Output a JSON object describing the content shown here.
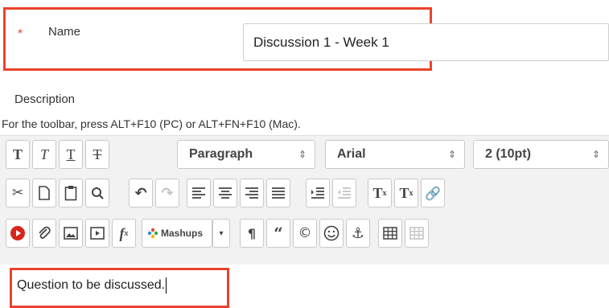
{
  "name_field": {
    "required_mark": "*",
    "label": "Name",
    "value": "Discussion 1 - Week 1"
  },
  "description": {
    "label": "Description",
    "toolbar_hint": "For the toolbar, press ALT+F10 (PC) or ALT+FN+F10 (Mac)."
  },
  "toolbar": {
    "format_select": "Paragraph",
    "font_select": "Arial",
    "size_select": "2 (10pt)",
    "mashups_label": "Mashups",
    "icons_row1": [
      "bold-icon",
      "italic-icon",
      "underline-icon",
      "strikethrough-icon"
    ],
    "icons_row2": [
      "cut-icon",
      "copy-icon",
      "paste-icon",
      "find-icon",
      "undo-icon",
      "redo-icon",
      "align-left-icon",
      "align-center-icon",
      "align-right-icon",
      "justify-icon",
      "indent-icon",
      "outdent-icon",
      "superscript-icon",
      "subscript-icon",
      "link-icon"
    ],
    "icons_row3": [
      "youtube-icon",
      "attachment-icon",
      "image-icon",
      "media-icon",
      "math-formula-icon",
      "mashups-icon",
      "paragraph-mark-icon",
      "blockquote-icon",
      "copyright-icon",
      "emoticon-icon",
      "anchor-icon",
      "table-icon",
      "table-grid-icon"
    ]
  },
  "editor": {
    "content": "Question to be discussed."
  },
  "colors": {
    "highlight": "#e8442c",
    "required": "#e24d33"
  }
}
